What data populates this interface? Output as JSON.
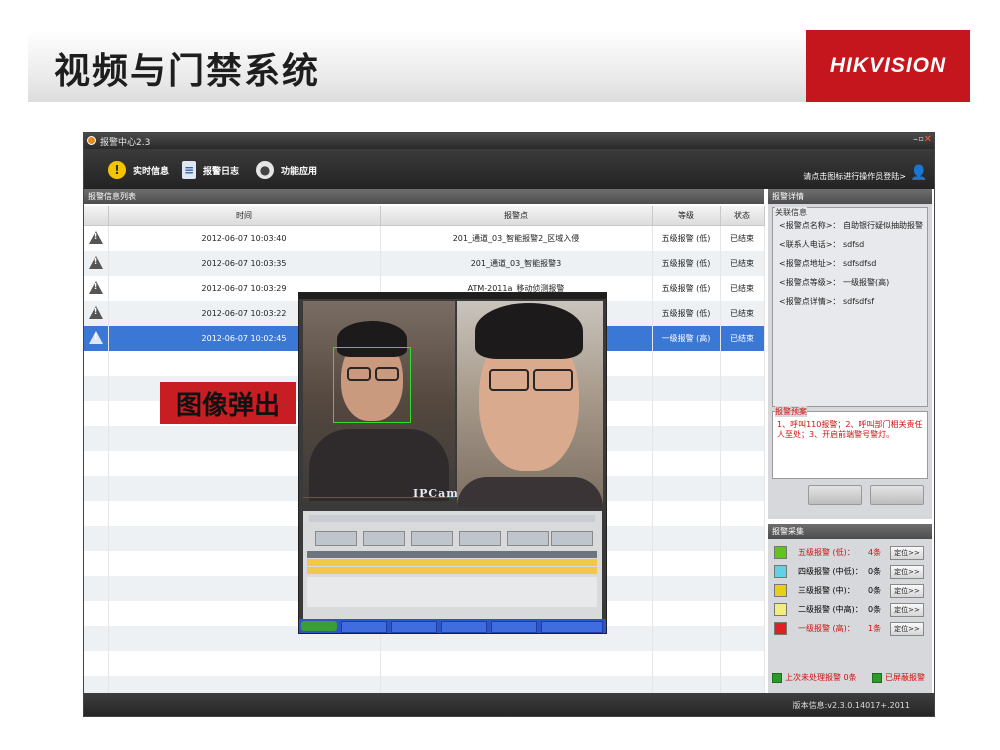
{
  "slide": {
    "title": "视频与门禁系统",
    "logo": "HIKVISION"
  },
  "app": {
    "title": "报警中心2.3",
    "toolbar": {
      "realtime_label": "实时信息",
      "log_label": "报警日志",
      "apps_label": "功能应用",
      "login_hint": "请点击图标进行操作员登陆>"
    },
    "list_panel": {
      "header": "报警信息列表",
      "columns": [
        "时间",
        "报警点",
        "等级",
        "状态"
      ],
      "rows": [
        {
          "time": "2012-06-07 10:03:40",
          "point": "201_通道_03_智能报警2_区域入侵",
          "level": "五级报警 (低)",
          "status": "已结束"
        },
        {
          "time": "2012-06-07 10:03:35",
          "point": "201_通道_03_智能报警3",
          "level": "五级报警 (低)",
          "status": "已结束"
        },
        {
          "time": "2012-06-07 10:03:29",
          "point": "ATM-2011a_移动侦测报警",
          "level": "五级报警 (低)",
          "status": "已结束"
        },
        {
          "time": "2012-06-07 10:03:22",
          "point": "",
          "level": "五级报警 (低)",
          "status": "已结束"
        },
        {
          "time": "2012-06-07 10:02:45",
          "point": "",
          "level": "一级报警 (高)",
          "status": "已结束"
        }
      ]
    },
    "detail_panel": {
      "header": "报警详情",
      "group_caption": "关联信息",
      "rows": [
        "<报警点名称>：  自助银行疑似抽助报警",
        "<联系人电话>：  sdfsd",
        "<报警点地址>：  sdfsdfsd",
        "<报警点等级>：  一级报警(高)",
        "<报警点详情>：  sdfsdfsf"
      ],
      "plan_caption": "报警预案",
      "plan_text": "1、呼叫110报警；2、呼叫部门相关责任人至处；3、开启前端警号警灯。"
    },
    "stat_panel": {
      "header": "报警采集",
      "rows": [
        {
          "label": "五级报警 (低)：",
          "count": "4条",
          "color": "#62c31f",
          "red": true
        },
        {
          "label": "四级报警 (中低)：",
          "count": "0条",
          "color": "#5fd3e3",
          "red": false
        },
        {
          "label": "三级报警 (中)：",
          "count": "0条",
          "color": "#e5cf1a",
          "red": false
        },
        {
          "label": "二级报警 (中高)：",
          "count": "0条",
          "color": "#f3ee7b",
          "red": false
        },
        {
          "label": "一级报警 (高)：",
          "count": "1条",
          "color": "#e02020",
          "red": true
        }
      ],
      "locate_label": "定位>>",
      "footer_left": "上次未处理报警 0条",
      "footer_right": "已屏蔽报警"
    },
    "status_bar": "版本信息:v2.3.0.14017+.2011"
  },
  "popup": {
    "overlay_text": "IPCam"
  },
  "callout": {
    "text": "图像弹出"
  },
  "colors": {
    "brand_red": "#c5161d",
    "selected_row": "#3b78d6",
    "toolbar_dark": "#2a2a2a"
  }
}
